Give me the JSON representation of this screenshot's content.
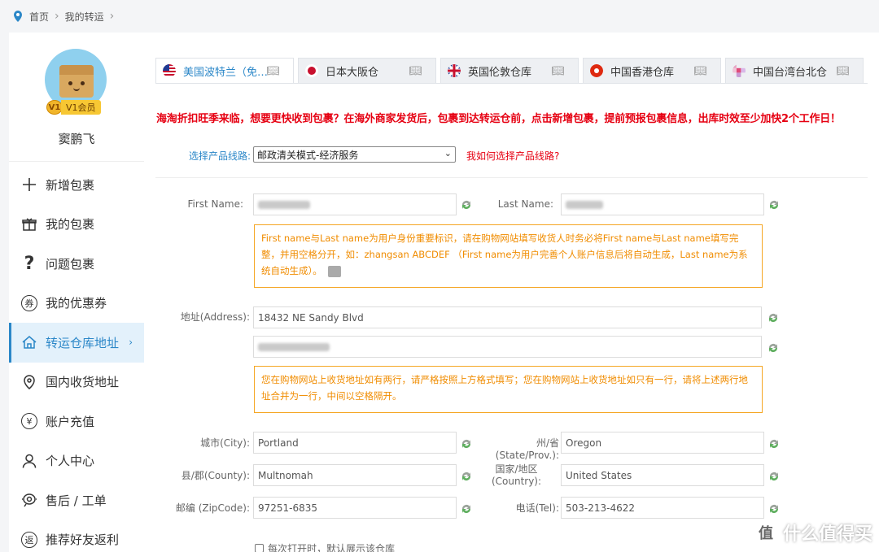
{
  "breadcrumb": {
    "home": "首页",
    "current": "我的转运"
  },
  "user": {
    "name": "窦鹏飞",
    "vip_badge": "V1",
    "vip_label": "V1会员"
  },
  "menu": [
    {
      "label": "新增包裹",
      "icon": "plus-icon"
    },
    {
      "label": "我的包裹",
      "icon": "gift-icon"
    },
    {
      "label": "问题包裹",
      "icon": "question-icon"
    },
    {
      "label": "我的优惠券",
      "icon": "coupon-icon"
    },
    {
      "label": "转运仓库地址",
      "icon": "home-icon",
      "active": true
    },
    {
      "label": "国内收货地址",
      "icon": "location-pin-icon"
    },
    {
      "label": "账户充值",
      "icon": "yen-icon"
    },
    {
      "label": "个人中心",
      "icon": "user-icon"
    },
    {
      "label": "售后 / 工单",
      "icon": "headset-icon"
    },
    {
      "label": "推荐好友返利",
      "icon": "return-icon"
    }
  ],
  "tabs": [
    {
      "label": "美国波特兰（免…",
      "flag": "us-flag-icon",
      "active": true
    },
    {
      "label": "日本大阪仓",
      "flag": "jp-flag-icon"
    },
    {
      "label": "英国伦敦仓库",
      "flag": "uk-flag-icon"
    },
    {
      "label": "中国香港仓库",
      "flag": "hk-flag-icon"
    },
    {
      "label": "中国台湾台北仓",
      "flag": "tw-flag-icon"
    }
  ],
  "notice": "海淘折扣旺季来临，想要更快收到包裹？在海外商家发货后，包裹到达转运仓前，点击新增包裹，提前预报包裹信息，出库时效至少加快2个工作日！",
  "route": {
    "label": "选择产品线路:",
    "selected": "邮政清关模式-经济服务",
    "help": "我如何选择产品线路?"
  },
  "form": {
    "first_name_label": "First Name:",
    "last_name_label": "Last Name:",
    "name_tip": "First name与Last name为用户身份重要标识，请在购物网站填写收货人时务必将First name与Last name填写完整，并用空格分开，如：zhangsan ABCDEF （First name为用户完善个人账户信息后将自动生成，Last name为系统自动生成）。",
    "address_label": "地址(Address):",
    "address_line1": "18432 NE Sandy Blvd",
    "address_tip": "您在购物网站上收货地址如有两行，请严格按照上方格式填写；您在购物网站上收货地址如只有一行，请将上述两行地址合并为一行，中间以空格隔开。",
    "city_label": "城市(City):",
    "city": "Portland",
    "state_label": "州/省(State/Prov.):",
    "state": "Oregon",
    "county_label": "县/郡(County):",
    "county": "Multnomah",
    "country_label_1": "国家/地区",
    "country_label_2": "(Country):",
    "country": "United States",
    "zip_label": "邮编 (ZipCode):",
    "zip": "97251-6835",
    "tel_label": "电话(Tel):",
    "tel": "503-213-4622",
    "default_check": "每次打开时，默认展示该仓库"
  },
  "watermark": {
    "logo": "值",
    "text": "什么值得买"
  },
  "colors": {
    "accent": "#2b87c8",
    "notice": "#e60012",
    "tip_border": "#f5a623",
    "tip_text": "#f08c00"
  }
}
